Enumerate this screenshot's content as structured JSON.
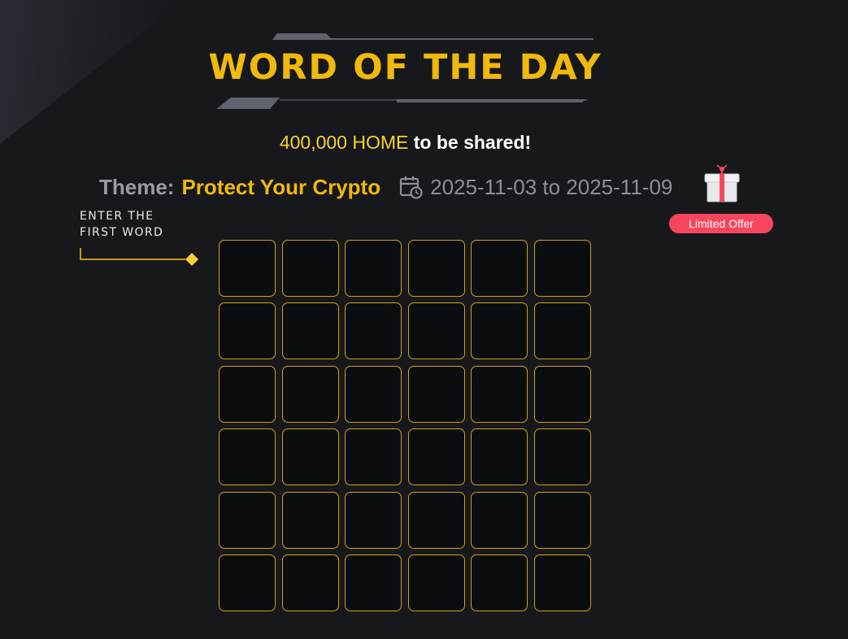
{
  "header": {
    "title": "WORD OF THE DAY",
    "reward_amount": "400,000 HOME",
    "reward_suffix": " to be shared!"
  },
  "theme": {
    "label": "Theme:",
    "value": "Protect Your Crypto",
    "date_range": "2025-11-03 to 2025-11-09",
    "calendar_icon": "calendar-clock-icon"
  },
  "promo": {
    "gift_icon": "gift-box-icon",
    "badge_label": "Limited Offer",
    "badge_color": "#f6465d"
  },
  "instruction": {
    "line1": "ENTER THE",
    "line2": "FIRST WORD"
  },
  "grid": {
    "rows": 6,
    "columns": 6,
    "cells": [
      [
        "",
        "",
        "",
        "",
        "",
        ""
      ],
      [
        "",
        "",
        "",
        "",
        "",
        ""
      ],
      [
        "",
        "",
        "",
        "",
        "",
        ""
      ],
      [
        "",
        "",
        "",
        "",
        "",
        ""
      ],
      [
        "",
        "",
        "",
        "",
        "",
        ""
      ],
      [
        "",
        "",
        "",
        "",
        "",
        ""
      ]
    ]
  },
  "colors": {
    "background": "#17181c",
    "accent": "#f0b90b",
    "cell_border": "#d2a20f",
    "cell_fill": "#0b0e11"
  }
}
